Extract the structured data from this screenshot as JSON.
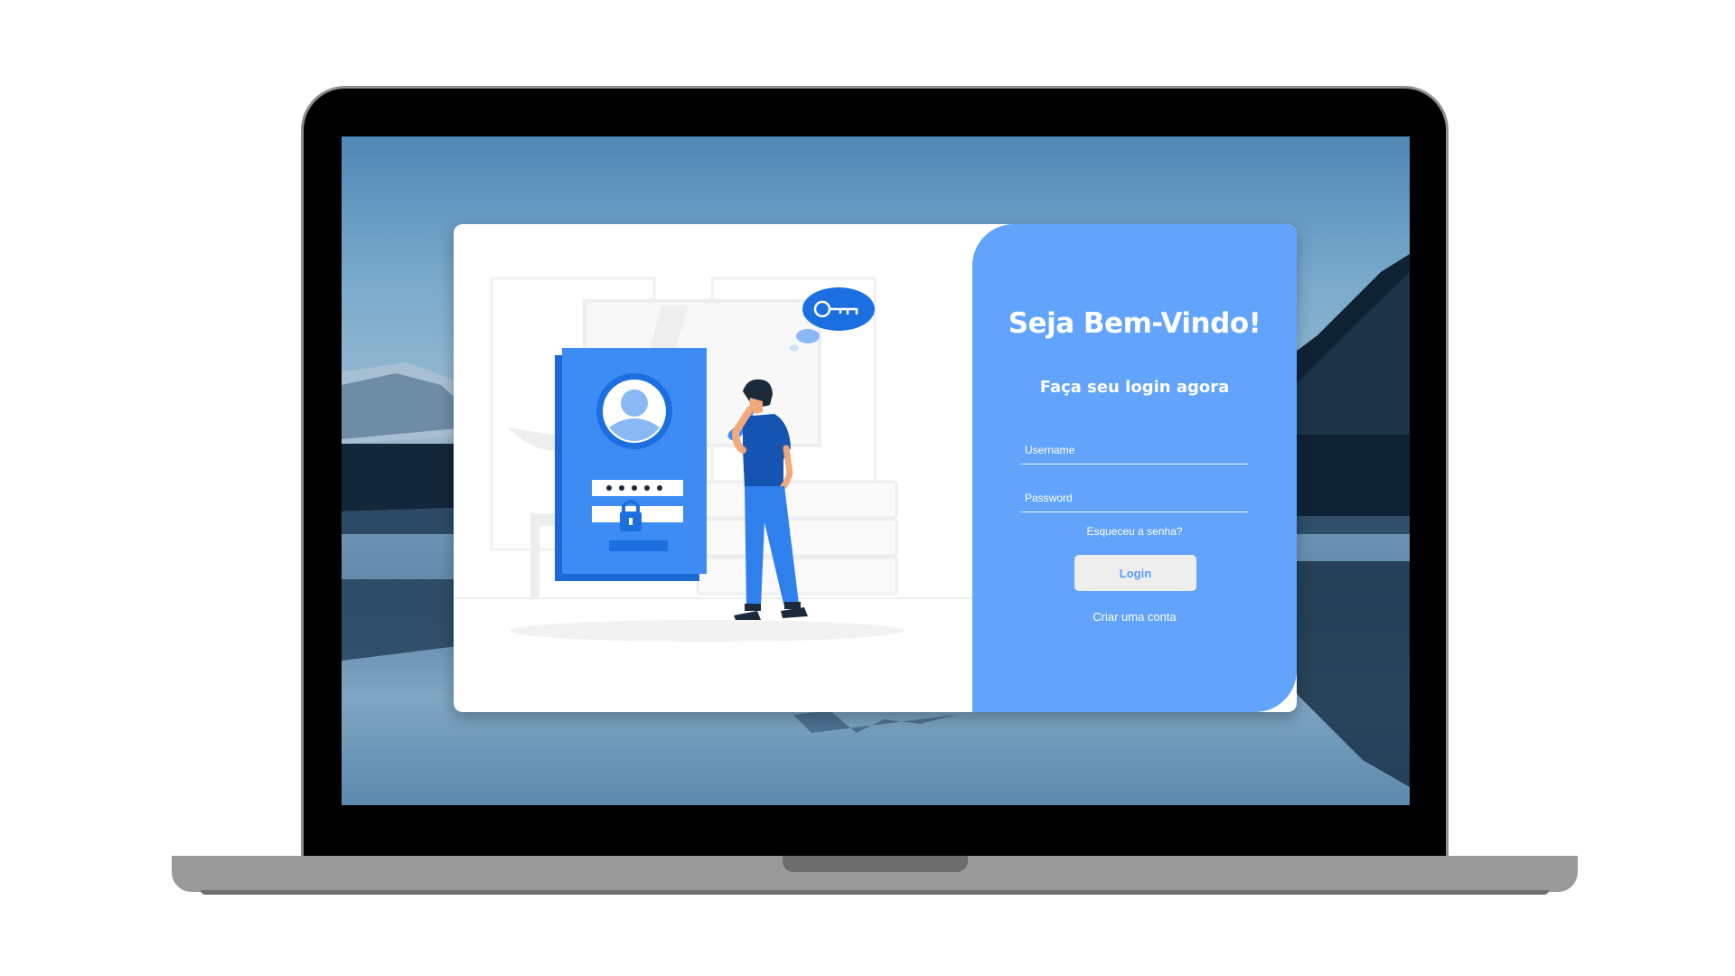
{
  "login": {
    "title": "Seja Bem-Vindo!",
    "subtitle": "Faça seu login agora",
    "username_placeholder": "Username",
    "password_placeholder": "Password",
    "forgot_password": "Esqueceu a senha?",
    "login_button": "Login",
    "create_account": "Criar uma conta"
  },
  "colors": {
    "panel": "#62a4fc",
    "accent": "#2f80ed",
    "button": "#eeeeee"
  }
}
